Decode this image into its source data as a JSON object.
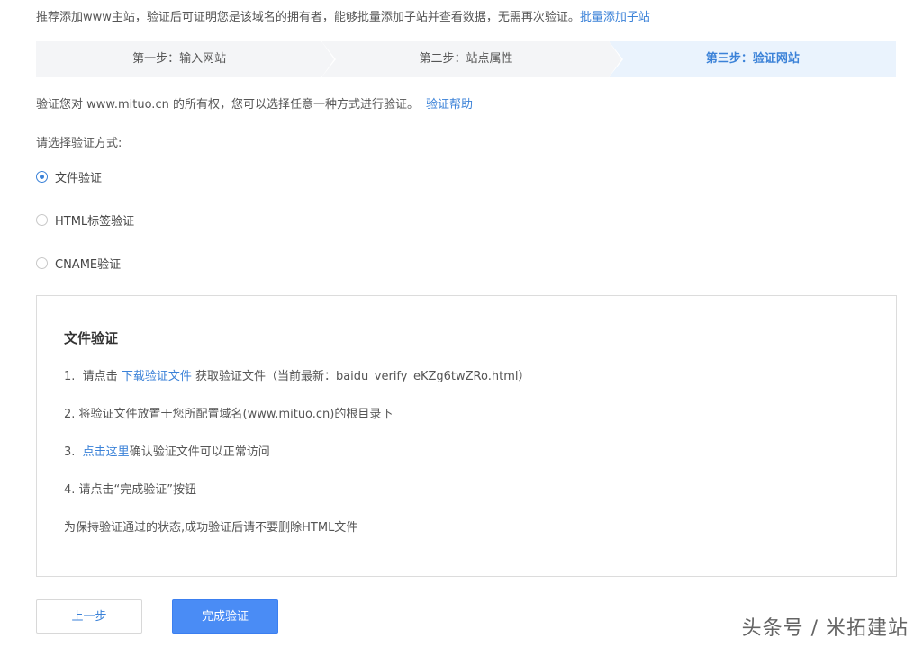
{
  "notice": {
    "text": "推荐添加www主站，验证后可证明您是该域名的拥有者，能够批量添加子站并查看数据，无需再次验证。",
    "link": "批量添加子站"
  },
  "steps": [
    {
      "label": "第一步：输入网站",
      "active": false
    },
    {
      "label": "第二步：站点属性",
      "active": false
    },
    {
      "label": "第三步：验证网站",
      "active": true
    }
  ],
  "intro": {
    "text": "验证您对 www.mituo.cn 的所有权，您可以选择任意一种方式进行验证。",
    "help_link": "验证帮助"
  },
  "method": {
    "label": "请选择验证方式:",
    "options": [
      {
        "label": "文件验证",
        "checked": true
      },
      {
        "label": "HTML标签验证",
        "checked": false
      },
      {
        "label": "CNAME验证",
        "checked": false
      }
    ]
  },
  "panel": {
    "title": "文件验证",
    "step1_prefix": "1.  请点击 ",
    "step1_link": "下载验证文件",
    "step1_suffix": " 获取验证文件（当前最新：baidu_verify_eKZg6twZRo.html）",
    "step2": "2.  将验证文件放置于您所配置域名(www.mituo.cn)的根目录下",
    "step3_prefix": "3.  ",
    "step3_link": "点击这里",
    "step3_suffix": "确认验证文件可以正常访问",
    "step4": "4.  请点击“完成验证”按钮",
    "note": "为保持验证通过的状态,成功验证后请不要删除HTML文件"
  },
  "buttons": {
    "prev": "上一步",
    "done": "完成验证"
  },
  "watermark": "头条号 / 米拓建站",
  "colors": {
    "accent": "#3b82d8",
    "primary_button": "#4a8cf5",
    "step_bg": "#f4f5f7",
    "step_active_bg": "#eaf3fd"
  }
}
